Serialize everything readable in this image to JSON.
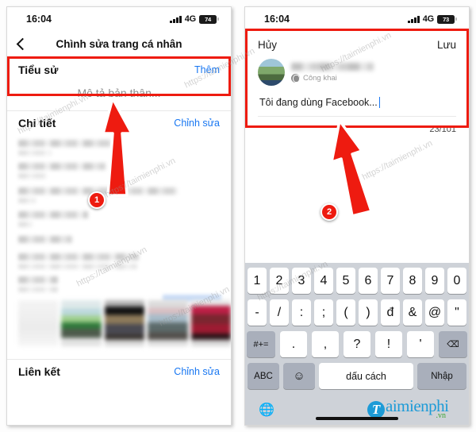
{
  "left_phone": {
    "status": {
      "time": "16:04",
      "network": "4G",
      "battery": "74"
    },
    "nav": {
      "title": "Chình sửa trang cá nhân",
      "back_icon": "back-chevron-icon"
    },
    "bio_section": {
      "title": "Tiểu sử",
      "action": "Thêm",
      "placeholder": "Mô tả bản thân..."
    },
    "details_section": {
      "title": "Chi tiết",
      "action": "Chỉnh sửa"
    },
    "links_section": {
      "title": "Liên kết",
      "action": "Chỉnh sửa"
    }
  },
  "right_phone": {
    "status": {
      "time": "16:04",
      "network": "4G",
      "battery": "73"
    },
    "composer": {
      "cancel": "Hủy",
      "save": "Lưu",
      "privacy": "Công khai",
      "privacy_icon": "globe-icon",
      "text": "Tôi đang dùng Facebook...",
      "counter": "23/101"
    },
    "keyboard": {
      "row1": [
        "1",
        "2",
        "3",
        "4",
        "5",
        "6",
        "7",
        "8",
        "9",
        "0"
      ],
      "row2": [
        "-",
        "/",
        ":",
        ";",
        "(",
        ")",
        "đ",
        "&",
        "@",
        "\""
      ],
      "row3": [
        "#+=",
        ".",
        ",",
        "?",
        "!",
        "'",
        "⌫"
      ],
      "row4": {
        "abc": "ABC",
        "emoji": "☺",
        "space": "dấu cách",
        "enter": "Nhập"
      },
      "globe_icon": "globe-keyboard-icon"
    },
    "logo": {
      "mark": "T",
      "word": "aimienphi",
      "tld": ".vn"
    }
  },
  "annotations": {
    "markers": [
      {
        "id": "1",
        "label": "1"
      },
      {
        "id": "2",
        "label": "2"
      }
    ],
    "accent_color": "#ee1b10",
    "link_color": "#1877f2"
  },
  "watermarks": [
    "https://taimienphi.vn",
    "https://taimienphi.vn",
    "https://taimienphi.vn",
    "https://taimienphi.vn",
    "https://taimienphi.vn",
    "https://taimienphi.vn",
    "https://taimienphi.vn",
    "https://taimienphi.vn"
  ]
}
